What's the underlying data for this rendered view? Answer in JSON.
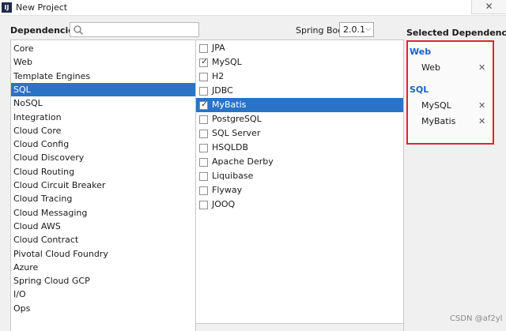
{
  "window": {
    "app_icon_text": "IJ",
    "title": "New Project",
    "close_glyph": "✕"
  },
  "header": {
    "dependencies_label": "Dependencies",
    "search_placeholder": "",
    "search_value": "",
    "spring_boot_label": "Spring Boot",
    "spring_boot_version": "2.0.1",
    "selected_label": "Selected Dependencies"
  },
  "categories": [
    {
      "label": "Core",
      "selected": false
    },
    {
      "label": "Web",
      "selected": false
    },
    {
      "label": "Template Engines",
      "selected": false
    },
    {
      "label": "SQL",
      "selected": true
    },
    {
      "label": "NoSQL",
      "selected": false
    },
    {
      "label": "Integration",
      "selected": false
    },
    {
      "label": "Cloud Core",
      "selected": false
    },
    {
      "label": "Cloud Config",
      "selected": false
    },
    {
      "label": "Cloud Discovery",
      "selected": false
    },
    {
      "label": "Cloud Routing",
      "selected": false
    },
    {
      "label": "Cloud Circuit Breaker",
      "selected": false
    },
    {
      "label": "Cloud Tracing",
      "selected": false
    },
    {
      "label": "Cloud Messaging",
      "selected": false
    },
    {
      "label": "Cloud AWS",
      "selected": false
    },
    {
      "label": "Cloud Contract",
      "selected": false
    },
    {
      "label": "Pivotal Cloud Foundry",
      "selected": false
    },
    {
      "label": "Azure",
      "selected": false
    },
    {
      "label": "Spring Cloud GCP",
      "selected": false
    },
    {
      "label": "I/O",
      "selected": false
    },
    {
      "label": "Ops",
      "selected": false
    }
  ],
  "dependencies": [
    {
      "label": "JPA",
      "checked": false,
      "highlighted": false
    },
    {
      "label": "MySQL",
      "checked": true,
      "highlighted": false
    },
    {
      "label": "H2",
      "checked": false,
      "highlighted": false
    },
    {
      "label": "JDBC",
      "checked": false,
      "highlighted": false
    },
    {
      "label": "MyBatis",
      "checked": true,
      "highlighted": true
    },
    {
      "label": "PostgreSQL",
      "checked": false,
      "highlighted": false
    },
    {
      "label": "SQL Server",
      "checked": false,
      "highlighted": false
    },
    {
      "label": "HSQLDB",
      "checked": false,
      "highlighted": false
    },
    {
      "label": "Apache Derby",
      "checked": false,
      "highlighted": false
    },
    {
      "label": "Liquibase",
      "checked": false,
      "highlighted": false
    },
    {
      "label": "Flyway",
      "checked": false,
      "highlighted": false
    },
    {
      "label": "JOOQ",
      "checked": false,
      "highlighted": false
    }
  ],
  "selected_dependencies": [
    {
      "group": "Web",
      "items": [
        "Web"
      ]
    },
    {
      "group": "SQL",
      "items": [
        "MySQL",
        "MyBatis"
      ]
    }
  ],
  "remove_glyph": "✕",
  "check_glyph": "✓",
  "chevron_glyph": "⌵",
  "watermark": "CSDN @af2yl",
  "colors": {
    "selection": "#2a73c7",
    "group_heading": "#1a63c7",
    "highlight_border": "#e0252b"
  }
}
